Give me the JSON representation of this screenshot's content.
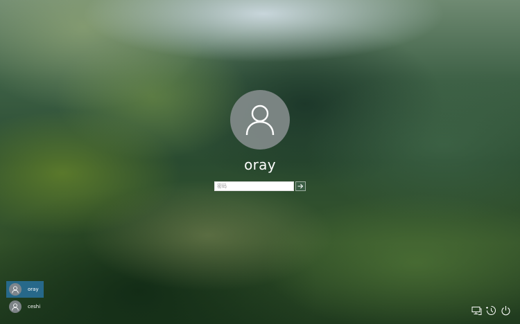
{
  "login": {
    "username": "oray",
    "password_placeholder": "密码",
    "password_value": ""
  },
  "users": [
    {
      "name": "oray",
      "selected": true
    },
    {
      "name": "ceshi",
      "selected": false
    }
  ],
  "icons": {
    "avatar": "user-silhouette-icon",
    "submit": "arrow-right-icon",
    "network": "network-icon",
    "accessibility": "ease-of-access-icon",
    "power": "power-icon"
  },
  "colors": {
    "selected_user_bg": "#286e96",
    "avatar_bg": "#848c8c",
    "submit_bg": "#3c5f46"
  }
}
